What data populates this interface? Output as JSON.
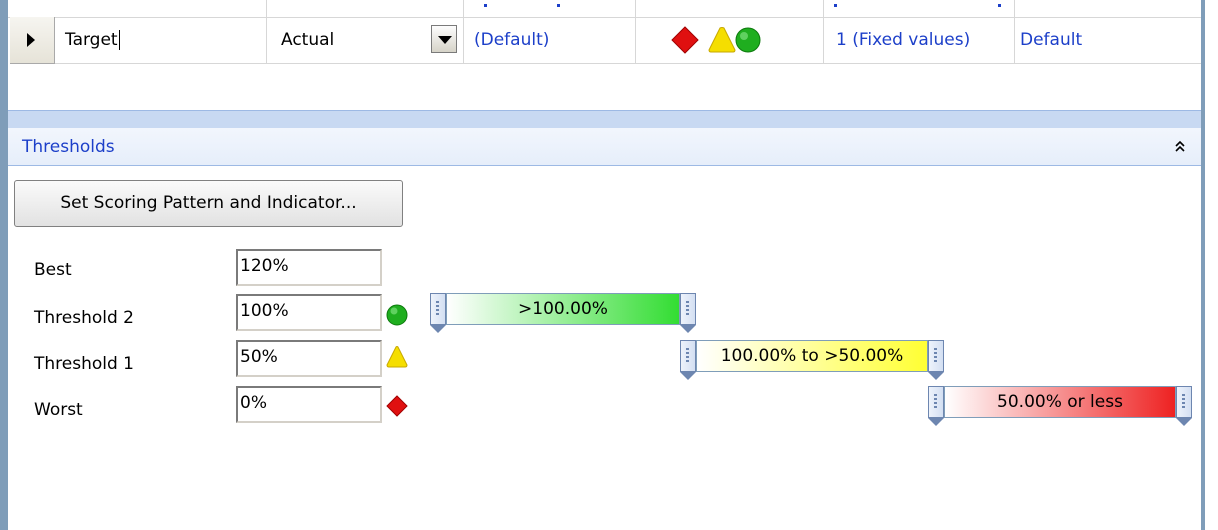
{
  "grid": {
    "row": {
      "name": "Target",
      "type": "Actual",
      "format": "(Default)",
      "indicator_icons": [
        "red-diamond-icon",
        "yellow-triangle-icon",
        "green-circle-icon"
      ],
      "bands": "1 (Fixed values)",
      "data_mapping": "Default"
    }
  },
  "thresholds": {
    "title": "Thresholds",
    "set_button_label": "Set Scoring Pattern and Indicator...",
    "rows": [
      {
        "label": "Best",
        "value": "120%"
      },
      {
        "label": "Threshold 2",
        "value": "100%",
        "icon": "green-circle-icon"
      },
      {
        "label": "Threshold 1",
        "value": "50%",
        "icon": "yellow-triangle-icon"
      },
      {
        "label": "Worst",
        "value": "0%",
        "icon": "red-diamond-icon"
      }
    ],
    "bands": [
      {
        "label": ">100.00%",
        "color": "#33dd33"
      },
      {
        "label": "100.00% to >50.00%",
        "color": "#ffff33"
      },
      {
        "label": "50.00% or less",
        "color": "#ee2222"
      }
    ]
  },
  "colors": {
    "link": "#1c3fc9",
    "border": "#7f9db9",
    "green": "#1fae1f",
    "yellow": "#f5de00",
    "red": "#e01010"
  }
}
